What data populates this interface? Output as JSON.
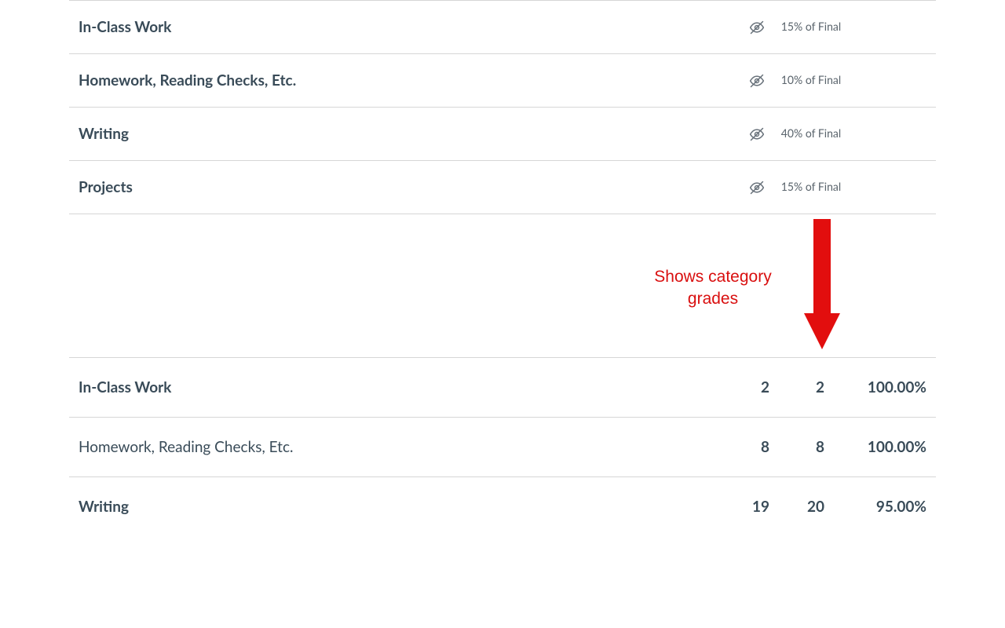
{
  "categories": [
    {
      "name": "In-Class Work",
      "weight": "15% of Final"
    },
    {
      "name": "Homework, Reading Checks, Etc.",
      "weight": "10% of Final"
    },
    {
      "name": "Writing",
      "weight": "40% of Final"
    },
    {
      "name": "Projects",
      "weight": "15% of Final"
    }
  ],
  "annotation": "Shows category grades",
  "results": [
    {
      "name": "In-Class Work",
      "earned": "2",
      "possible": "2",
      "percent": "100.00%"
    },
    {
      "name": "Homework, Reading Checks, Etc.",
      "earned": "8",
      "possible": "8",
      "percent": "100.00%"
    },
    {
      "name": "Writing",
      "earned": "19",
      "possible": "20",
      "percent": "95.00%"
    }
  ]
}
